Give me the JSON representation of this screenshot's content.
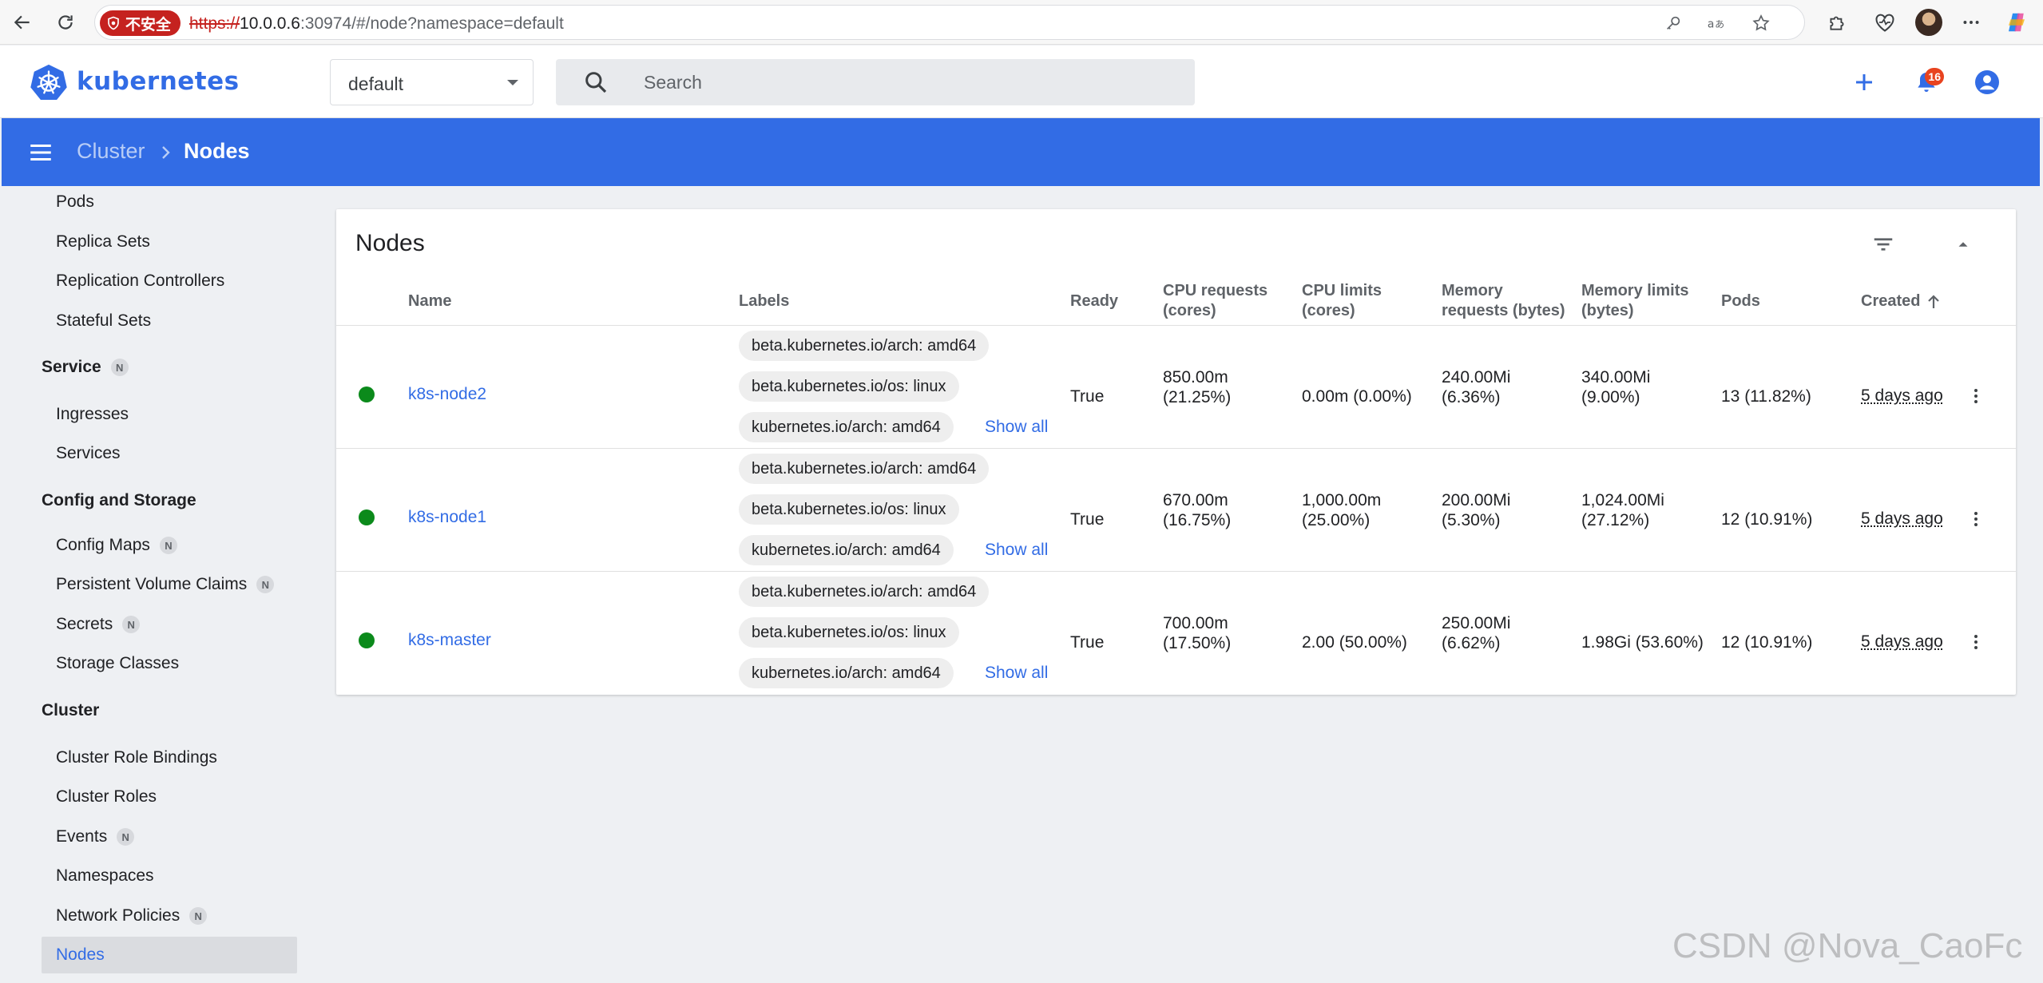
{
  "browser": {
    "security_label": "不安全",
    "url_scheme": "https://",
    "url_host": "10.0.0.6",
    "url_rest": ":30974/#/node?namespace=default"
  },
  "header": {
    "brand": "kubernetes",
    "namespace": "default",
    "search_placeholder": "Search",
    "notification_count": "16"
  },
  "breadcrumb": {
    "parent": "Cluster",
    "current": "Nodes"
  },
  "sidebar": {
    "workloads_items": [
      {
        "label": "Pods"
      },
      {
        "label": "Replica Sets"
      },
      {
        "label": "Replication Controllers"
      },
      {
        "label": "Stateful Sets"
      }
    ],
    "service_section": {
      "label": "Service",
      "badge": "N"
    },
    "service_items": [
      {
        "label": "Ingresses"
      },
      {
        "label": "Services"
      }
    ],
    "config_section": {
      "label": "Config and Storage"
    },
    "config_items": [
      {
        "label": "Config Maps",
        "badge": "N"
      },
      {
        "label": "Persistent Volume Claims",
        "badge": "N"
      },
      {
        "label": "Secrets",
        "badge": "N"
      },
      {
        "label": "Storage Classes"
      }
    ],
    "cluster_section": {
      "label": "Cluster"
    },
    "cluster_items": [
      {
        "label": "Cluster Role Bindings"
      },
      {
        "label": "Cluster Roles"
      },
      {
        "label": "Events",
        "badge": "N"
      },
      {
        "label": "Namespaces"
      },
      {
        "label": "Network Policies",
        "badge": "N"
      },
      {
        "label": "Nodes"
      }
    ]
  },
  "card": {
    "title": "Nodes",
    "columns": {
      "name": "Name",
      "labels": "Labels",
      "ready": "Ready",
      "cpu_requests": [
        "CPU requests",
        "(cores)"
      ],
      "cpu_limits": [
        "CPU limits",
        "(cores)"
      ],
      "mem_requests": [
        "Memory",
        "requests (bytes)"
      ],
      "mem_limits": [
        "Memory limits",
        "(bytes)"
      ],
      "pods": "Pods",
      "created": "Created"
    },
    "show_all_label": "Show all",
    "rows": [
      {
        "status_color": "#0b8a1b",
        "name": "k8s-node2",
        "labels": [
          "beta.kubernetes.io/arch: amd64",
          "beta.kubernetes.io/os: linux",
          "kubernetes.io/arch: amd64"
        ],
        "ready": "True",
        "cpu_requests": [
          "850.00m",
          "(21.25%)"
        ],
        "cpu_limits": [
          "0.00m (0.00%)"
        ],
        "mem_requests": [
          "240.00Mi",
          "(6.36%)"
        ],
        "mem_limits": [
          "340.00Mi",
          "(9.00%)"
        ],
        "pods": "13 (11.82%)",
        "created": "5 days ago"
      },
      {
        "status_color": "#0b8a1b",
        "name": "k8s-node1",
        "labels": [
          "beta.kubernetes.io/arch: amd64",
          "beta.kubernetes.io/os: linux",
          "kubernetes.io/arch: amd64"
        ],
        "ready": "True",
        "cpu_requests": [
          "670.00m",
          "(16.75%)"
        ],
        "cpu_limits": [
          "1,000.00m",
          "(25.00%)"
        ],
        "mem_requests": [
          "200.00Mi",
          "(5.30%)"
        ],
        "mem_limits": [
          "1,024.00Mi",
          "(27.12%)"
        ],
        "pods": "12 (10.91%)",
        "created": "5 days ago"
      },
      {
        "status_color": "#0b8a1b",
        "name": "k8s-master",
        "labels": [
          "beta.kubernetes.io/arch: amd64",
          "beta.kubernetes.io/os: linux",
          "kubernetes.io/arch: amd64"
        ],
        "ready": "True",
        "cpu_requests": [
          "700.00m",
          "(17.50%)"
        ],
        "cpu_limits": [
          "2.00 (50.00%)"
        ],
        "mem_requests": [
          "250.00Mi",
          "(6.62%)"
        ],
        "mem_limits": [
          "1.98Gi (53.60%)"
        ],
        "pods": "12 (10.91%)",
        "created": "5 days ago"
      }
    ]
  },
  "watermark": "CSDN @Nova_CaoFc",
  "colors": {
    "brand_blue": "#326ce5",
    "ready_green": "#0b8a1b",
    "badge_red": "#e8431f"
  }
}
